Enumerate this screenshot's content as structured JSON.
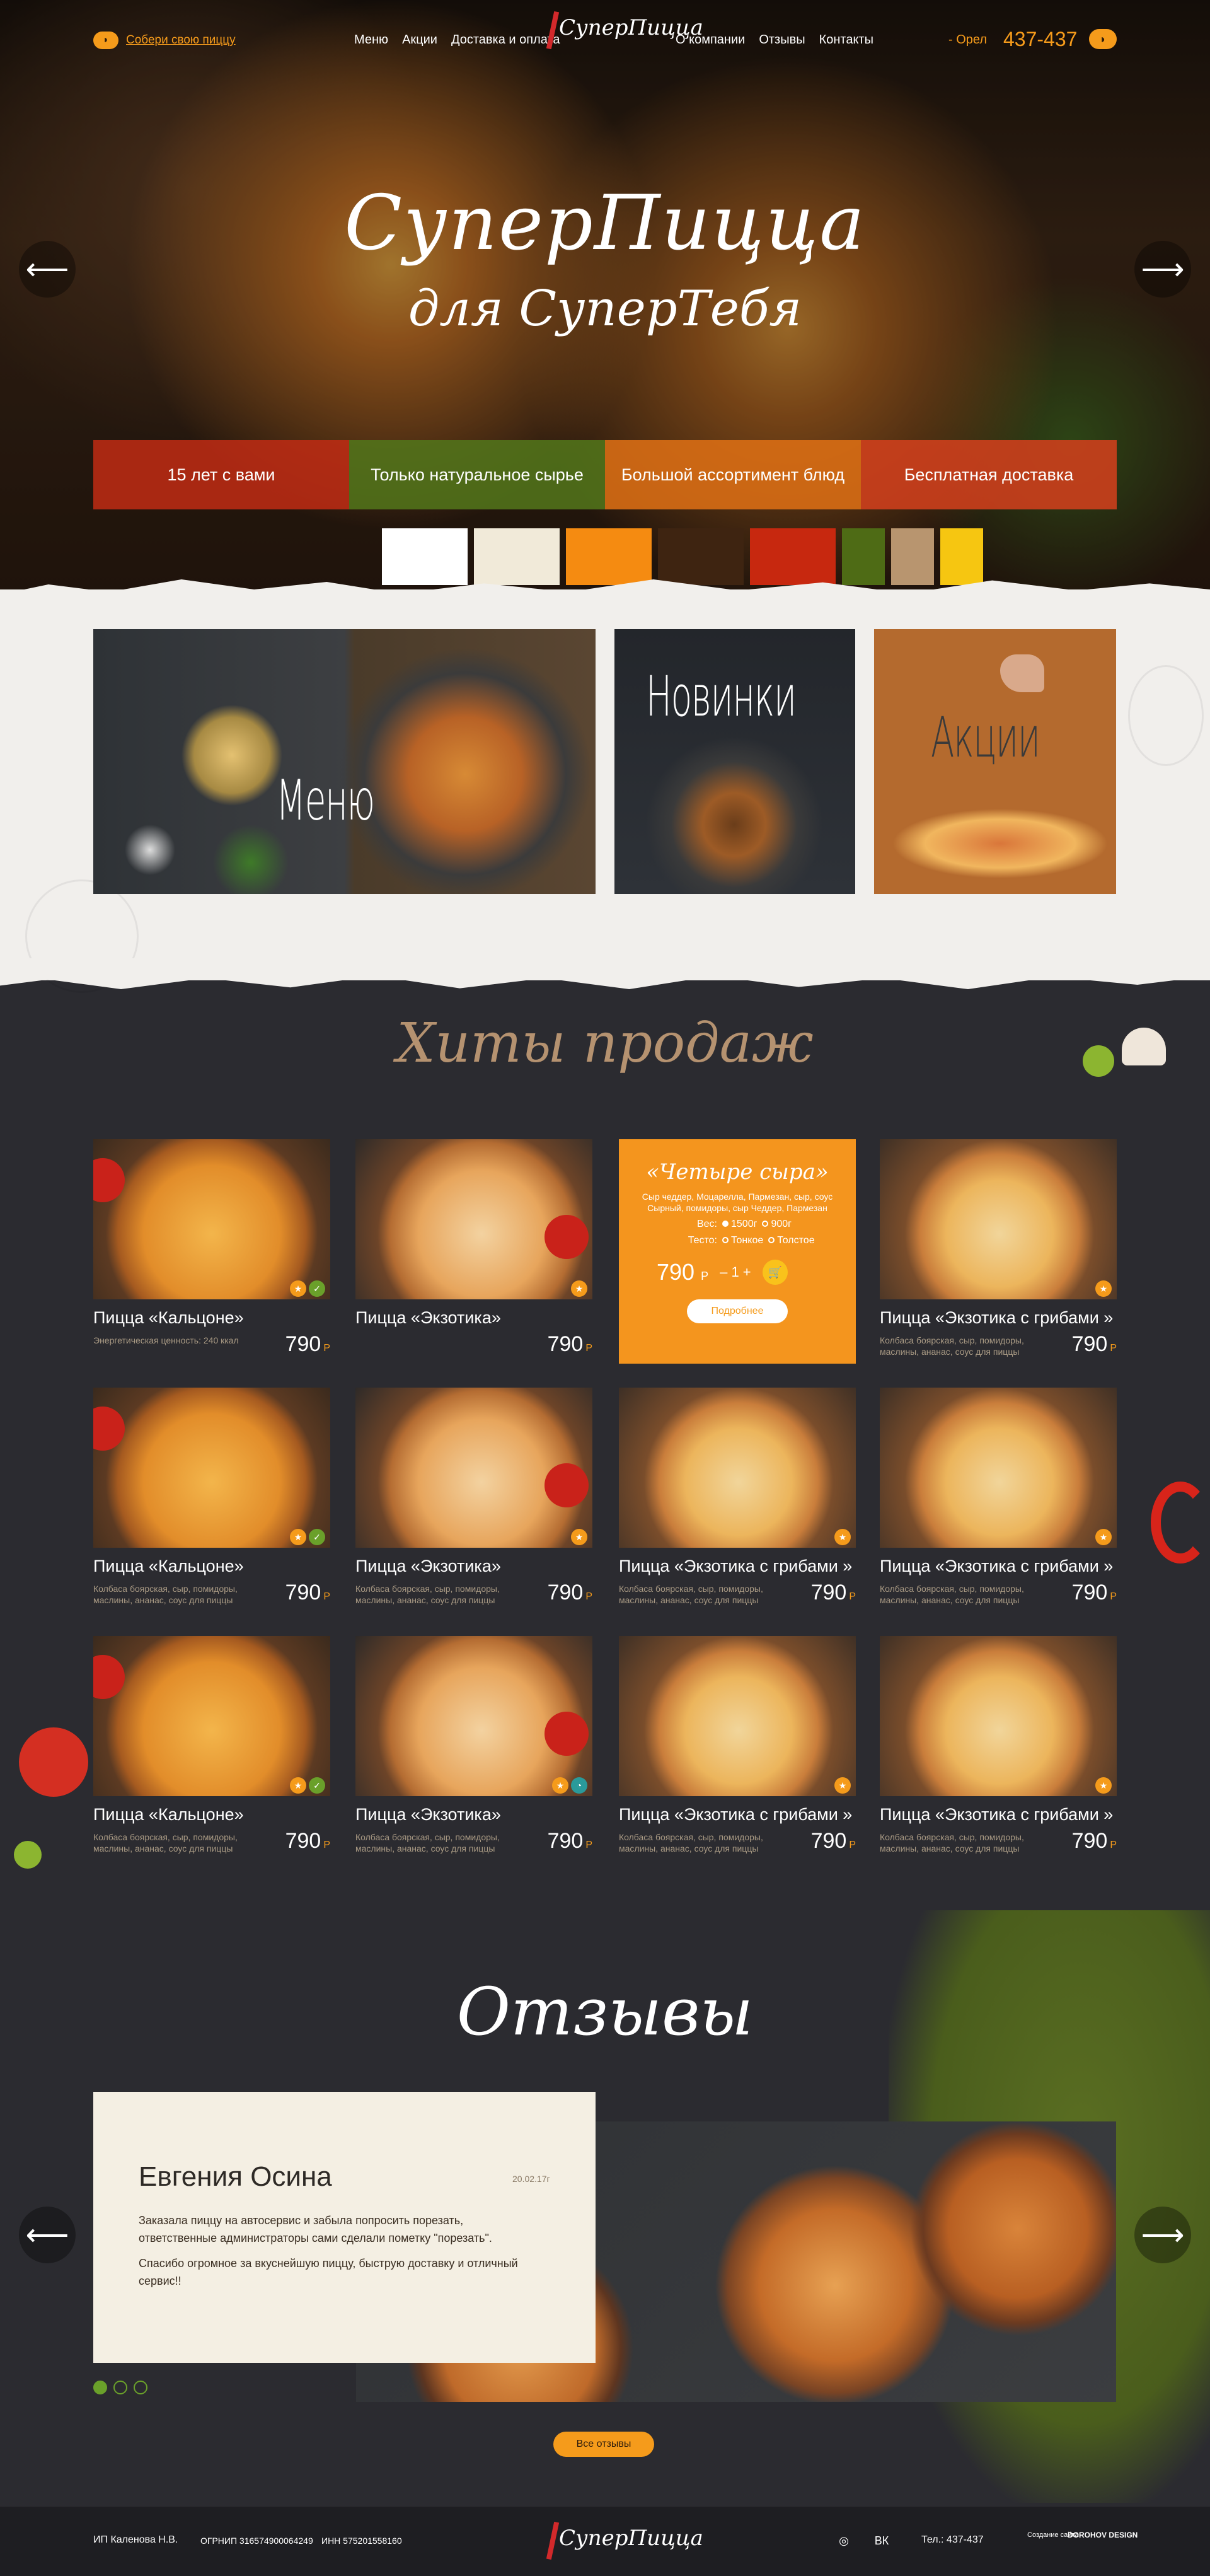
{
  "header": {
    "build_pizza": "Собери свою пиццу",
    "nav_left": [
      "Меню",
      "Акции",
      "Доставка и оплата"
    ],
    "logo": "СуперПицца",
    "nav_right": [
      "О компании",
      "Отзывы",
      "Контакты"
    ],
    "city": "- Орел",
    "phone": "437-437"
  },
  "hero": {
    "title": "СуперПицца",
    "subtitle": "для СуперТебя",
    "features": [
      "15 лет с вами",
      "Только натуральное сырье",
      "Большой ассортимент блюд",
      "Бесплатная доставка"
    ],
    "palette": [
      "#ffffff",
      "#f1ead9",
      "#f58b11",
      "#3e2411",
      "#c7280f",
      "#4e6b15",
      "#b8956f",
      "#f6c611"
    ]
  },
  "categories": {
    "menu": "Меню",
    "new": "Новинки",
    "promo": "Акции"
  },
  "hits": {
    "title": "Хиты продаж",
    "featured": {
      "name": "«Четыре сыра»",
      "ingredients": "Сыр чеддер, Моцарелла, Пармезан, сыр, соус Сырный, помидоры, сыр Чеддер, Пармезан",
      "weight_label": "Вес:",
      "weight_options": [
        "1500г",
        "900г"
      ],
      "dough_label": "Тесто:",
      "dough_options": [
        "Тонкое",
        "Толстое"
      ],
      "price": "790",
      "currency": "Р",
      "qty": "– 1 +",
      "more": "Подробнее"
    },
    "items": [
      {
        "name": "Пицца «Кальцоне»",
        "desc": "Энергетическая ценность: 240 ккал",
        "price": "790"
      },
      {
        "name": "Пицца «Экзотика»",
        "desc": "",
        "price": "790"
      },
      {
        "name": "",
        "desc": "",
        "price": ""
      },
      {
        "name": "Пицца «Экзотика с грибами »",
        "desc": "Колбаса боярская, сыр, помидоры, маслины, ананас, соус для пиццы",
        "price": "790"
      },
      {
        "name": "Пицца «Кальцоне»",
        "desc": "Колбаса боярская, сыр, помидоры, маслины, ананас, соус для пиццы",
        "price": "790"
      },
      {
        "name": "Пицца «Экзотика»",
        "desc": "Колбаса боярская, сыр, помидоры, маслины, ананас, соус для пиццы",
        "price": "790"
      },
      {
        "name": "Пицца «Экзотика с грибами »",
        "desc": "Колбаса боярская, сыр, помидоры, маслины, ананас, соус для пиццы",
        "price": "790"
      },
      {
        "name": "Пицца «Экзотика с грибами »",
        "desc": "Колбаса боярская, сыр, помидоры, маслины, ананас, соус для пиццы",
        "price": "790"
      },
      {
        "name": "Пицца «Кальцоне»",
        "desc": "Колбаса боярская, сыр, помидоры, маслины, ананас, соус для пиццы",
        "price": "790"
      },
      {
        "name": "Пицца «Экзотика»",
        "desc": "Колбаса боярская, сыр, помидоры, маслины, ананас, соус для пиццы",
        "price": "790"
      },
      {
        "name": "Пицца «Экзотика с грибами »",
        "desc": "Колбаса боярская, сыр, помидоры, маслины, ананас, соус для пиццы",
        "price": "790"
      },
      {
        "name": "Пицца «Экзотика с грибами »",
        "desc": "Колбаса боярская, сыр, помидоры, маслины, ананас, соус для пиццы",
        "price": "790"
      }
    ],
    "currency": "Р"
  },
  "reviews": {
    "title": "Отзывы",
    "name": "Евгения Осина",
    "date": "20.02.17г",
    "text1": "Заказала пиццу на автосервис и забыла попросить порезать, ответственные администраторы сами сделали пометку \"порезать\".",
    "text2": "Спасибо огромное за вкуснейшую пиццу, быструю доставку и отличный сервис!!",
    "all": "Все отзывы"
  },
  "footer": {
    "owner": "ИП Каленова Н.В.",
    "ogrnip": "ОГРНИП 316574900064249",
    "inn": "ИНН 575201558160",
    "logo": "СуперПицца",
    "phone": "Тел.: 437-437",
    "made_by": "Создание сайта",
    "studio": "DOROHOV DESIGN"
  }
}
